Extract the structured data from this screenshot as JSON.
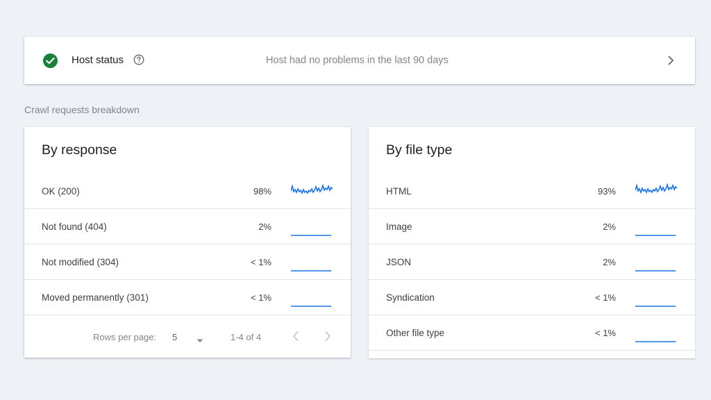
{
  "host_status": {
    "title": "Host status",
    "message": "Host had no problems in the last 90 days",
    "status_color": "#188038",
    "icons": [
      "check-circle-icon",
      "help-icon",
      "chevron-right-icon"
    ]
  },
  "section_title": "Crawl requests breakdown",
  "by_response": {
    "title": "By response",
    "rows": [
      {
        "label": "OK (200)",
        "pct": "98%",
        "trend": "fluctuating"
      },
      {
        "label": "Not found (404)",
        "pct": "2%",
        "trend": "flat"
      },
      {
        "label": "Not modified (304)",
        "pct": "< 1%",
        "trend": "flat"
      },
      {
        "label": "Moved permanently (301)",
        "pct": "< 1%",
        "trend": "flat"
      }
    ],
    "pagination": {
      "rows_per_page_label": "Rows per page:",
      "rows_per_page_value": "5",
      "range": "1-4 of 4"
    }
  },
  "by_file_type": {
    "title": "By file type",
    "rows": [
      {
        "label": "HTML",
        "pct": "93%",
        "trend": "fluctuating"
      },
      {
        "label": "Image",
        "pct": "2%",
        "trend": "flat"
      },
      {
        "label": "JSON",
        "pct": "2%",
        "trend": "flat"
      },
      {
        "label": "Syndication",
        "pct": "< 1%",
        "trend": "flat"
      },
      {
        "label": "Other file type",
        "pct": "< 1%",
        "trend": "flat"
      }
    ]
  },
  "sparkline_color": "#1a73e8"
}
